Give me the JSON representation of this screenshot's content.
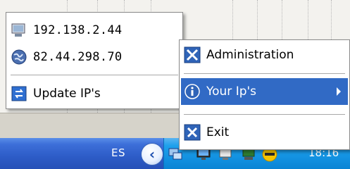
{
  "tray": {
    "language": "ES",
    "clock": "18:16",
    "icons": [
      "show-hidden-icons-arrow-icon",
      "network-icon",
      "monitor-icon",
      "display-icon",
      "security-shield-icon"
    ]
  },
  "left_menu": {
    "items": [
      {
        "label": "192.138.2.44",
        "icon": "local-network-icon"
      },
      {
        "label": "82.44.298.70",
        "icon": "globe-icon"
      },
      {
        "label": "Update IP's",
        "icon": "refresh-icon"
      }
    ]
  },
  "right_menu": {
    "items": [
      {
        "label": "Administration",
        "icon": "tools-icon"
      },
      {
        "label": "Your Ip's",
        "icon": "info-icon",
        "selected": true
      },
      {
        "label": "Exit",
        "icon": "close-icon"
      }
    ]
  },
  "colors": {
    "selection": "#316ac5",
    "taskbar": "#2d5cc7",
    "tray": "#118fdf"
  }
}
